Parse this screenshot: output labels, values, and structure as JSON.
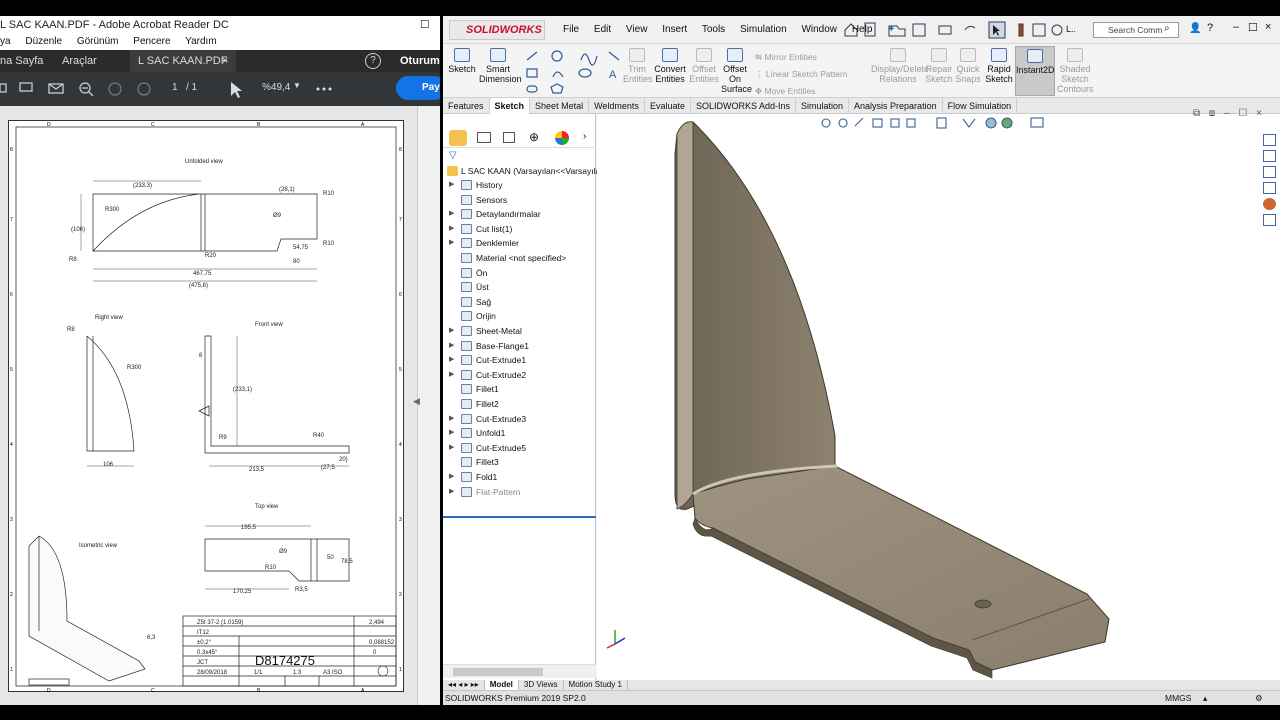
{
  "acrobat": {
    "window_title": "L SAC KAAN.PDF - Adobe Acrobat Reader DC",
    "menu": [
      "ya",
      "Düzenle",
      "Görünüm",
      "Pencere",
      "Yardım"
    ],
    "tabs": {
      "home": "na Sayfa",
      "tools": "Araçlar",
      "doc": "L SAC KAAN.PDF"
    },
    "help_icon": "question-icon",
    "signin": "Oturum",
    "share": "Payl",
    "page_current": "1",
    "page_total": "/ 1",
    "zoom": "%49,4",
    "drawing": {
      "col_labels": [
        "D",
        "C",
        "B",
        "A"
      ],
      "row_labels": [
        "8",
        "7",
        "6",
        "5",
        "4",
        "3",
        "2",
        "1"
      ],
      "unfolded_title": "Unfolded view",
      "right_title": "Right view",
      "front_title": "Front view",
      "top_title": "Top view",
      "iso_title": "Isometric view",
      "dims_unfolded": [
        "(233,3)",
        "(28,1)",
        "R10",
        "R300",
        "(106)",
        "Ø9",
        "R20",
        "R10",
        "54,75",
        "R8",
        "80",
        "467,75",
        "(475,8)"
      ],
      "dims_right": [
        "R8",
        "R300",
        "106"
      ],
      "dims_front": [
        "8",
        "(233,1)",
        "R9",
        "R40",
        "213,5",
        "(27,5",
        "20)"
      ],
      "dims_top": [
        "195,5",
        "Ø9",
        "50",
        "78,5",
        "R10",
        "R3,5",
        "170,25"
      ],
      "surface": "6,3",
      "title_block": {
        "material": "Z5t 37-2 (1.0159)",
        "tolerance": "IT12",
        "angle_tol": "±0,2°",
        "chamfer": "0,3x45°",
        "author": "JCT",
        "date": "28/09/2018",
        "sheet": "1/1",
        "scale": "1:3",
        "size": "A3 ISO",
        "number": "D8174275",
        "mass": "2,494",
        "area": "0,088152",
        "rev": "0"
      }
    }
  },
  "solidworks": {
    "logo": "SOLIDWORKS",
    "menu": [
      "File",
      "Edit",
      "View",
      "Insert",
      "Tools",
      "Simulation",
      "Window",
      "Help"
    ],
    "search_placeholder": "Search Comm",
    "commands": {
      "sketch": "Sketch",
      "smart_dim": [
        "Smart",
        "Dimension"
      ],
      "trim": [
        "Trim",
        "Entities"
      ],
      "convert": [
        "Convert",
        "Entities"
      ],
      "offset": [
        "Offset",
        "Entities"
      ],
      "offset_surface": [
        "Offset",
        "On",
        "Surface"
      ],
      "mirror": "Mirror Entities",
      "linear_pattern": "Linear Sketch Pattern",
      "move": "Move Entities",
      "display_delete": [
        "Display/Delete",
        "Relations"
      ],
      "repair": [
        "Repair",
        "Sketch"
      ],
      "quick_snaps": [
        "Quick",
        "Snaps"
      ],
      "rapid": [
        "Rapid",
        "Sketch"
      ],
      "instant2d": "Instant2D",
      "shaded": [
        "Shaded",
        "Sketch",
        "Contours"
      ]
    },
    "tabs": [
      "Features",
      "Sketch",
      "Sheet Metal",
      "Weldments",
      "Evaluate",
      "SOLIDWORKS Add-Ins",
      "Simulation",
      "Analysis Preparation",
      "Flow Simulation"
    ],
    "active_tab": "Sketch",
    "tree": {
      "root": "L SAC KAAN  (Varsayılan<<Varsayılan",
      "items": [
        {
          "label": "History",
          "arrow": true
        },
        {
          "label": "Sensors",
          "arrow": false
        },
        {
          "label": "Detaylandırmalar",
          "arrow": true
        },
        {
          "label": "Cut list(1)",
          "arrow": true
        },
        {
          "label": "Denklemler",
          "arrow": true
        },
        {
          "label": "Material <not specified>",
          "arrow": false
        },
        {
          "label": "Ön",
          "arrow": false
        },
        {
          "label": "Üst",
          "arrow": false
        },
        {
          "label": "Sağ",
          "arrow": false
        },
        {
          "label": "Orijin",
          "arrow": false
        },
        {
          "label": "Sheet-Metal",
          "arrow": true
        },
        {
          "label": "Base-Flange1",
          "arrow": true
        },
        {
          "label": "Cut-Extrude1",
          "arrow": true
        },
        {
          "label": "Cut-Extrude2",
          "arrow": true
        },
        {
          "label": "Fillet1",
          "arrow": false
        },
        {
          "label": "Fillet2",
          "arrow": false
        },
        {
          "label": "Cut-Extrude3",
          "arrow": true
        },
        {
          "label": "Unfold1",
          "arrow": true
        },
        {
          "label": "Cut-Extrude5",
          "arrow": true
        },
        {
          "label": "Fillet3",
          "arrow": false
        },
        {
          "label": "Fold1",
          "arrow": true
        },
        {
          "label": "Flat-Pattern",
          "arrow": true
        }
      ]
    },
    "bottom_tabs": [
      "Model",
      "3D Views",
      "Motion Study 1"
    ],
    "status": "SOLIDWORKS Premium 2019 SP2.0",
    "units": "MMGS",
    "colors": {
      "part": "#8a7e6c",
      "part_light": "#b3a996",
      "part_dark": "#5e5546",
      "accent": "#c8102e"
    }
  }
}
